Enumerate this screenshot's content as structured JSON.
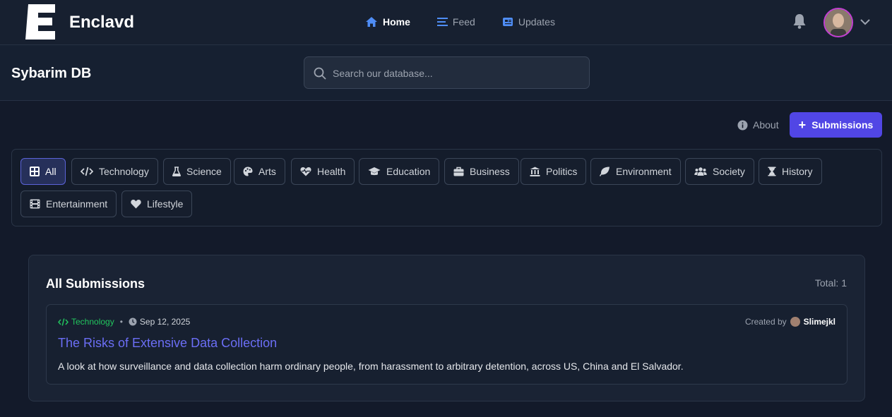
{
  "brand": {
    "logo_letter": "E",
    "name": "Enclavd"
  },
  "nav": [
    {
      "label": "Home",
      "icon": "home-icon"
    },
    {
      "label": "Feed",
      "icon": "list-icon"
    },
    {
      "label": "Updates",
      "icon": "newspaper-icon"
    }
  ],
  "header": {
    "db_title": "Sybarim DB"
  },
  "search": {
    "placeholder": "Search our database...",
    "value": ""
  },
  "actions": {
    "about_label": "About",
    "submissions_label": "Submissions"
  },
  "categories": [
    {
      "label": "All",
      "icon": "grid-icon"
    },
    {
      "label": "Technology",
      "icon": "code-icon"
    },
    {
      "label": "Science",
      "icon": "flask-icon"
    },
    {
      "label": "Arts",
      "icon": "palette-icon"
    },
    {
      "label": "Health",
      "icon": "heart-pulse-icon"
    },
    {
      "label": "Education",
      "icon": "graduation-cap-icon"
    },
    {
      "label": "Business",
      "icon": "briefcase-icon"
    },
    {
      "label": "Politics",
      "icon": "landmark-icon"
    },
    {
      "label": "Environment",
      "icon": "leaf-icon"
    },
    {
      "label": "Society",
      "icon": "users-icon"
    },
    {
      "label": "History",
      "icon": "hourglass-icon"
    },
    {
      "label": "Entertainment",
      "icon": "film-icon"
    },
    {
      "label": "Lifestyle",
      "icon": "heart-icon"
    }
  ],
  "submissions": {
    "heading": "All Submissions",
    "total_label": "Total: 1",
    "items": [
      {
        "category": "Technology",
        "date": "Sep 12, 2025",
        "created_by_label": "Created by",
        "author": "Slimejkl",
        "title": "The Risks of Extensive Data Collection",
        "description": "A look at how surveillance and data collection harm ordinary people, from harassment to arbitrary detention, across US, China and El Salvador."
      }
    ]
  },
  "colors": {
    "accent": "#5146e5",
    "link": "#6b6ef5",
    "category_green": "#22c55e",
    "background": "#131a2a"
  }
}
